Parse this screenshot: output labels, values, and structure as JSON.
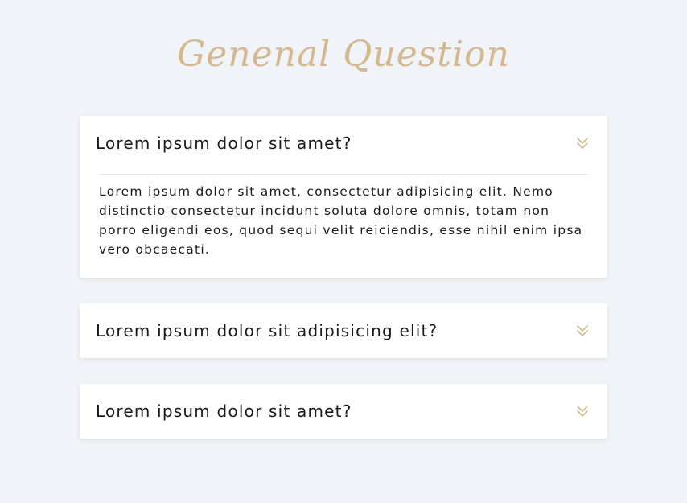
{
  "page": {
    "title": "Genenal Question"
  },
  "colors": {
    "background": "#f0f3f7",
    "accent": "#d4b98f",
    "card": "#ffffff",
    "text": "#1a1a1a"
  },
  "faq": {
    "items": [
      {
        "question": "Lorem ipsum dolor sit amet?",
        "answer": "Lorem ipsum dolor sit amet, consectetur adipisicing elit. Nemo distinctio consectetur incidunt soluta dolore omnis, totam non porro eligendi eos, quod sequi velit reiciendis, esse nihil enim ipsa vero obcaecati.",
        "expanded": true,
        "icon": "chevron-double-down-icon"
      },
      {
        "question": "Lorem ipsum dolor sit adipisicing elit?",
        "expanded": false,
        "icon": "chevron-double-down-icon"
      },
      {
        "question": "Lorem ipsum dolor sit amet?",
        "expanded": false,
        "icon": "chevron-double-down-icon"
      }
    ]
  }
}
